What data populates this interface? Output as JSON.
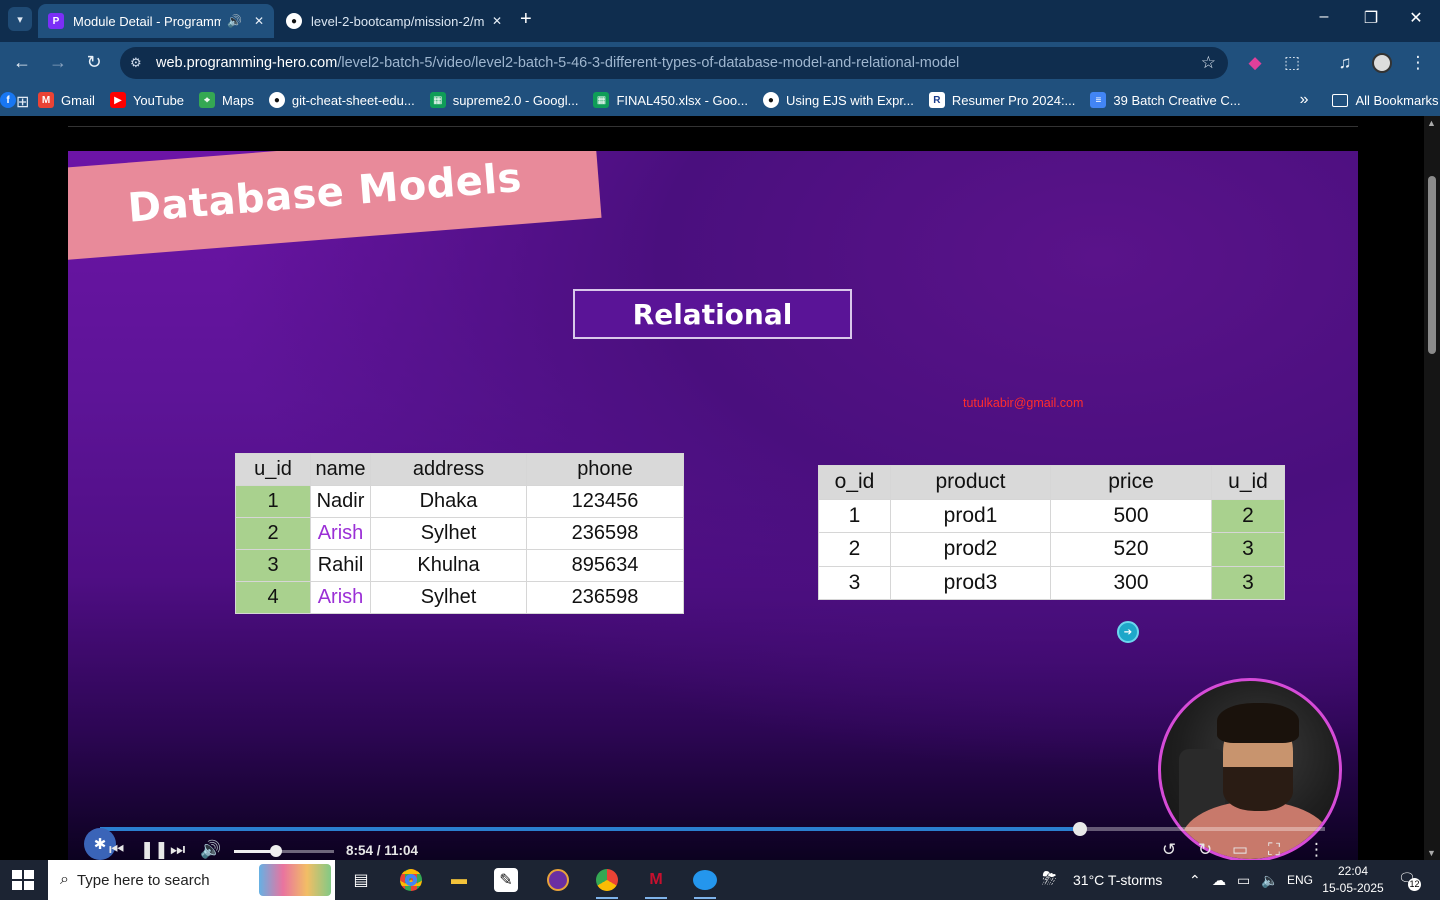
{
  "browser": {
    "tabs": [
      {
        "title": "Module Detail - Programming Hero",
        "active": true,
        "audio": true
      },
      {
        "title": "level-2-bootcamp/mission-2/m",
        "active": false
      }
    ],
    "url_host": "web.programming-hero.com",
    "url_path": "/level2-batch-5/video/level2-batch-5-46-3-different-types-of-database-model-and-relational-model",
    "bookmarks": [
      {
        "label": "",
        "icon": "facebook-icon",
        "color": "#1877f2"
      },
      {
        "label": "Gmail",
        "icon": "gmail-icon",
        "color": "#ea4335"
      },
      {
        "label": "YouTube",
        "icon": "youtube-icon",
        "color": "#ff0000"
      },
      {
        "label": "Maps",
        "icon": "maps-icon",
        "color": "#34a853"
      },
      {
        "label": "git-cheat-sheet-edu...",
        "icon": "github-icon",
        "color": "#24292e"
      },
      {
        "label": "supreme2.0 - Googl...",
        "icon": "sheets-icon",
        "color": "#0f9d58"
      },
      {
        "label": "FINAL450.xlsx - Goo...",
        "icon": "sheets-icon",
        "color": "#0f9d58"
      },
      {
        "label": "Using EJS with Expr...",
        "icon": "github-icon",
        "color": "#24292e"
      },
      {
        "label": "Resumer Pro 2024:...",
        "icon": "resumer-icon",
        "color": "#1a3c8c"
      },
      {
        "label": "39 Batch Creative C...",
        "icon": "docs-icon",
        "color": "#4285f4"
      }
    ],
    "all_bookmarks": "All Bookmarks"
  },
  "slide": {
    "banner": "Database Models",
    "subtitle": "Relational",
    "email": "tutulkabir@gmail.com",
    "users_table": {
      "headers": [
        "u_id",
        "name",
        "address",
        "phone"
      ],
      "rows": [
        [
          "1",
          "Nadir",
          "Dhaka",
          "123456"
        ],
        [
          "2",
          "Arish",
          "Sylhet",
          "236598"
        ],
        [
          "3",
          "Rahil",
          "Khulna",
          "895634"
        ],
        [
          "4",
          "Arish",
          "Sylhet",
          "236598"
        ]
      ]
    },
    "orders_table": {
      "headers": [
        "o_id",
        "product",
        "price",
        "u_id"
      ],
      "rows": [
        [
          "1",
          "prod1",
          "500",
          "2"
        ],
        [
          "2",
          "prod2",
          "520",
          "3"
        ],
        [
          "3",
          "prod3",
          "300",
          "3"
        ]
      ]
    }
  },
  "player": {
    "time": "8:54 / 11:04",
    "progress_fraction": 0.8,
    "volume_fraction": 0.42
  },
  "taskbar": {
    "search_placeholder": "Type here to search",
    "weather": "31°C  T-storms",
    "language": "ENG",
    "time": "22:04",
    "date": "15-05-2025",
    "notifications": "12"
  }
}
